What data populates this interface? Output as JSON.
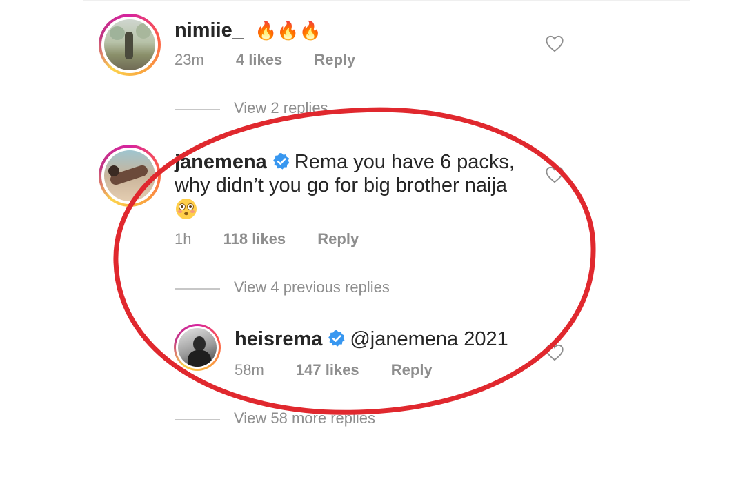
{
  "colors": {
    "accent_verified": "#3897f0",
    "muted_text": "#8e8e8e",
    "annotation_circle": "#e0282e",
    "story_ring": "#d6249f"
  },
  "comments": [
    {
      "username": "nimiie_",
      "text": "🔥🔥🔥",
      "time": "23m",
      "likes": "4 likes",
      "reply": "Reply",
      "verified": false,
      "avatar_icon": "avatar-photo-outdoor"
    },
    {
      "username": "janemena",
      "text_line1": "Rema you have 6 packs,",
      "text_line2": "why didn’t you go for big brother naija",
      "emoji": "flushed-face-icon",
      "time": "1h",
      "likes": "118 likes",
      "reply": "Reply",
      "verified": true,
      "avatar_icon": "avatar-photo-beach"
    }
  ],
  "reply": {
    "username": "heisrema",
    "mention": "@janemena",
    "text": "2021",
    "time": "58m",
    "likes": "147 likes",
    "reply": "Reply",
    "verified": true
  },
  "view_links": {
    "first": "View 2 replies",
    "second": "View 4 previous replies",
    "third": "View 58 more replies"
  },
  "icons": [
    "heart-icon",
    "verified-badge-icon",
    "fire-emoji",
    "flushed-face-icon"
  ]
}
